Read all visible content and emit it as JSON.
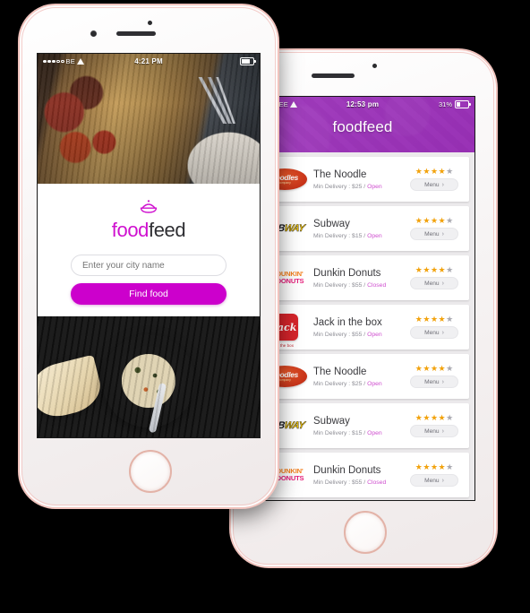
{
  "front_phone": {
    "status_bar": {
      "carrier": "BE",
      "time": "4:21 PM",
      "battery_pct": 72,
      "signal_dots_filled": 3,
      "signal_dots_total": 5
    },
    "login": {
      "logo_part_a": "food",
      "logo_part_b": "feed",
      "logo_icon": "bowl-dome-icon",
      "city_placeholder": "Enter your city name",
      "city_value": "",
      "find_button_label": "Find food"
    },
    "photos": {
      "top_alt": "rustic wooden table with sauce bottles and cutlery",
      "bottom_alt": "bowl of rice pilaf with naan bread"
    }
  },
  "back_phone": {
    "status_bar": {
      "carrier": "EE",
      "time": "12:53 pm",
      "battery_label": "31%",
      "battery_pct": 31,
      "signal_dots_filled": 2,
      "signal_dots_total": 5,
      "wifi_icon": "wifi-icon"
    },
    "header": {
      "title": "foodfeed",
      "accent_color": "#a23cb8"
    },
    "list": {
      "menu_label": "Menu",
      "chevron_icon": "chevron-right-icon",
      "min_delivery_prefix": "Min Delivery : ",
      "status_open": "Open",
      "status_closed": "Closed",
      "star_color": "#f2a20c",
      "star_dim_color": "#a9a9b0",
      "rows": [
        {
          "name": "The Noodle",
          "logo": "noodles-company-logo",
          "meta": "Min Delivery : $25 / ",
          "min_delivery": "$25",
          "status": "Open",
          "stars_filled": 4,
          "stars_total": 5
        },
        {
          "name": "Subway",
          "logo": "subway-logo",
          "meta": "Min Delivery : $15 / ",
          "min_delivery": "$15",
          "status": "Open",
          "stars_filled": 4,
          "stars_total": 5
        },
        {
          "name": "Dunkin Donuts",
          "logo": "dunkin-donuts-logo",
          "meta": "Min Delivery : $55 / ",
          "min_delivery": "$55",
          "status": "Closed",
          "stars_filled": 4,
          "stars_total": 5
        },
        {
          "name": "Jack in the box",
          "logo": "jack-in-the-box-logo",
          "meta": "Min Delivery : $55 / ",
          "min_delivery": "$55",
          "status": "Open",
          "stars_filled": 4,
          "stars_total": 5
        },
        {
          "name": "The Noodle",
          "logo": "noodles-company-logo",
          "meta": "Min Delivery : $25 / ",
          "min_delivery": "$25",
          "status": "Open",
          "stars_filled": 4,
          "stars_total": 5
        },
        {
          "name": "Subway",
          "logo": "subway-logo",
          "meta": "Min Delivery : $15 / ",
          "min_delivery": "$15",
          "status": "Open",
          "stars_filled": 4,
          "stars_total": 5
        },
        {
          "name": "Dunkin Donuts",
          "logo": "dunkin-donuts-logo",
          "meta": "Min Delivery : $55 / ",
          "min_delivery": "$55",
          "status": "Closed",
          "stars_filled": 4,
          "stars_total": 5
        }
      ]
    }
  },
  "brand_text": {
    "noodles_name": "noodles",
    "noodles_sub": "company",
    "subway_a": "SUB",
    "subway_b": "WAY",
    "dunkin_a": "DUNKIN'",
    "dunkin_b": "DONUTS",
    "jack_name": "Jack",
    "jack_sub": "in the box"
  },
  "theme": {
    "magenta": "#cc00cc",
    "purple_header": "#a23cb8",
    "star_gold": "#f2a20c",
    "page_bg": "#000000"
  }
}
